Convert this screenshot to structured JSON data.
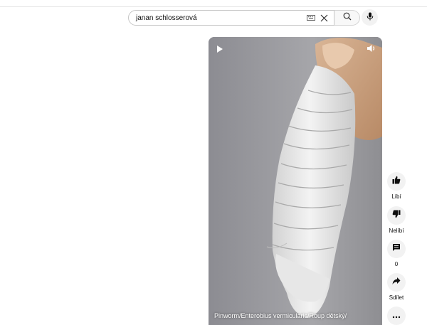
{
  "search": {
    "query": "janan schlosserová"
  },
  "player": {
    "title": "Pinworm/Enterobius vermicularis/Roup dětský/"
  },
  "actions": {
    "like_label": "Líbí",
    "dislike_label": "Nelíbí",
    "comments_count": "0",
    "share_label": "Sdílet"
  },
  "icons": {
    "keyboard": "keyboard-icon",
    "clear": "close-icon",
    "search": "search-icon",
    "mic": "mic-icon",
    "play": "play-icon",
    "volume": "volume-icon",
    "like": "thumb-up-icon",
    "dislike": "thumb-down-icon",
    "comment": "comment-icon",
    "share": "share-icon",
    "more": "more-icon"
  }
}
